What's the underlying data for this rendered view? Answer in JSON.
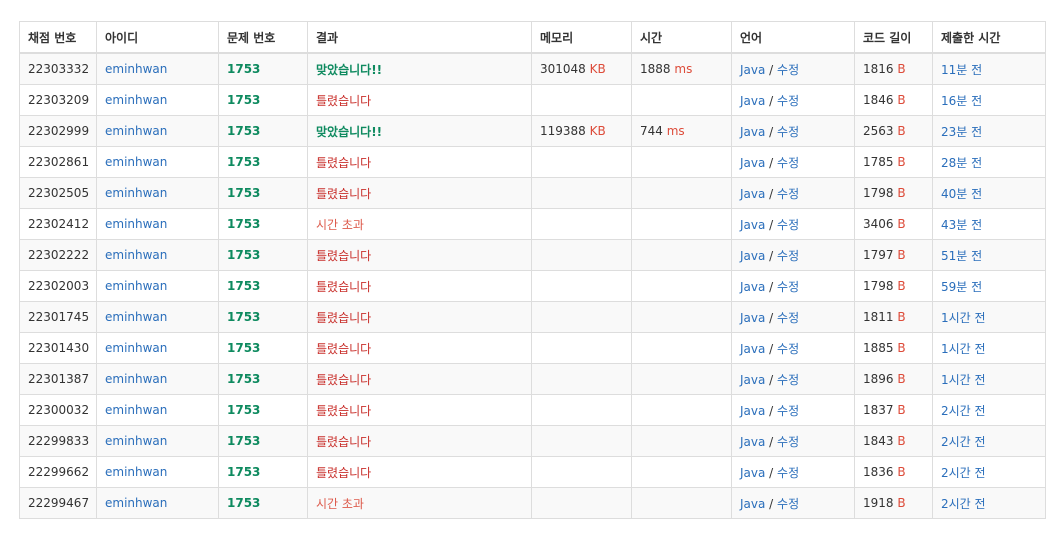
{
  "headers": [
    "채점 번호",
    "아이디",
    "문제 번호",
    "결과",
    "메모리",
    "시간",
    "언어",
    "코드 길이",
    "제출한 시간"
  ],
  "units": {
    "memory": "KB",
    "time": "ms",
    "code": "B"
  },
  "lang_sep": " / ",
  "rows": [
    {
      "id": "22303332",
      "user": "eminhwan",
      "problem": "1753",
      "result": "맞았습니다!!",
      "result_type": "ac",
      "memory": "301048",
      "time": "1888",
      "lang": "Java",
      "edit": "수정",
      "code_len": "1816",
      "submitted": "11분 전"
    },
    {
      "id": "22303209",
      "user": "eminhwan",
      "problem": "1753",
      "result": "틀렸습니다",
      "result_type": "wa",
      "memory": "",
      "time": "",
      "lang": "Java",
      "edit": "수정",
      "code_len": "1846",
      "submitted": "16분 전"
    },
    {
      "id": "22302999",
      "user": "eminhwan",
      "problem": "1753",
      "result": "맞았습니다!!",
      "result_type": "ac",
      "memory": "119388",
      "time": "744",
      "lang": "Java",
      "edit": "수정",
      "code_len": "2563",
      "submitted": "23분 전"
    },
    {
      "id": "22302861",
      "user": "eminhwan",
      "problem": "1753",
      "result": "틀렸습니다",
      "result_type": "wa",
      "memory": "",
      "time": "",
      "lang": "Java",
      "edit": "수정",
      "code_len": "1785",
      "submitted": "28분 전"
    },
    {
      "id": "22302505",
      "user": "eminhwan",
      "problem": "1753",
      "result": "틀렸습니다",
      "result_type": "wa",
      "memory": "",
      "time": "",
      "lang": "Java",
      "edit": "수정",
      "code_len": "1798",
      "submitted": "40분 전"
    },
    {
      "id": "22302412",
      "user": "eminhwan",
      "problem": "1753",
      "result": "시간 초과",
      "result_type": "tle",
      "memory": "",
      "time": "",
      "lang": "Java",
      "edit": "수정",
      "code_len": "3406",
      "submitted": "43분 전"
    },
    {
      "id": "22302222",
      "user": "eminhwan",
      "problem": "1753",
      "result": "틀렸습니다",
      "result_type": "wa",
      "memory": "",
      "time": "",
      "lang": "Java",
      "edit": "수정",
      "code_len": "1797",
      "submitted": "51분 전"
    },
    {
      "id": "22302003",
      "user": "eminhwan",
      "problem": "1753",
      "result": "틀렸습니다",
      "result_type": "wa",
      "memory": "",
      "time": "",
      "lang": "Java",
      "edit": "수정",
      "code_len": "1798",
      "submitted": "59분 전"
    },
    {
      "id": "22301745",
      "user": "eminhwan",
      "problem": "1753",
      "result": "틀렸습니다",
      "result_type": "wa",
      "memory": "",
      "time": "",
      "lang": "Java",
      "edit": "수정",
      "code_len": "1811",
      "submitted": "1시간 전"
    },
    {
      "id": "22301430",
      "user": "eminhwan",
      "problem": "1753",
      "result": "틀렸습니다",
      "result_type": "wa",
      "memory": "",
      "time": "",
      "lang": "Java",
      "edit": "수정",
      "code_len": "1885",
      "submitted": "1시간 전"
    },
    {
      "id": "22301387",
      "user": "eminhwan",
      "problem": "1753",
      "result": "틀렸습니다",
      "result_type": "wa",
      "memory": "",
      "time": "",
      "lang": "Java",
      "edit": "수정",
      "code_len": "1896",
      "submitted": "1시간 전"
    },
    {
      "id": "22300032",
      "user": "eminhwan",
      "problem": "1753",
      "result": "틀렸습니다",
      "result_type": "wa",
      "memory": "",
      "time": "",
      "lang": "Java",
      "edit": "수정",
      "code_len": "1837",
      "submitted": "2시간 전"
    },
    {
      "id": "22299833",
      "user": "eminhwan",
      "problem": "1753",
      "result": "틀렸습니다",
      "result_type": "wa",
      "memory": "",
      "time": "",
      "lang": "Java",
      "edit": "수정",
      "code_len": "1843",
      "submitted": "2시간 전"
    },
    {
      "id": "22299662",
      "user": "eminhwan",
      "problem": "1753",
      "result": "틀렸습니다",
      "result_type": "wa",
      "memory": "",
      "time": "",
      "lang": "Java",
      "edit": "수정",
      "code_len": "1836",
      "submitted": "2시간 전"
    },
    {
      "id": "22299467",
      "user": "eminhwan",
      "problem": "1753",
      "result": "시간 초과",
      "result_type": "tle",
      "memory": "",
      "time": "",
      "lang": "Java",
      "edit": "수정",
      "code_len": "1918",
      "submitted": "2시간 전"
    }
  ],
  "colors": {
    "accepted": "#0e8a5f",
    "wrong": "#c9302c",
    "timeout": "#dd5b4c",
    "link": "#2a6ebb",
    "unit": "#dd4b39"
  }
}
